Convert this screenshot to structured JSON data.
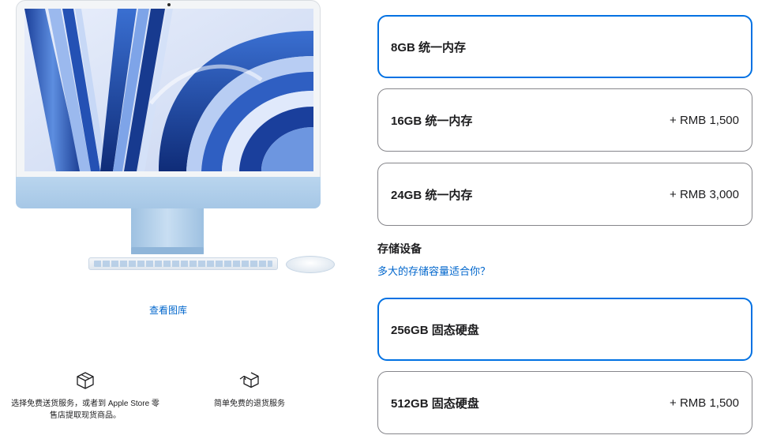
{
  "product": {
    "gallery_link": "查看图库",
    "perks": [
      {
        "icon": "box-icon",
        "line1": "选择免费送货服务，或者到 Apple Store 零",
        "line2": "售店提取现货商品。"
      },
      {
        "icon": "return-box-icon",
        "line1": "简单免费的退货服务"
      }
    ],
    "colors": {
      "accent": "#0071e3",
      "link": "#0066cc",
      "imac_blue": "#a6c7e6"
    }
  },
  "memory": {
    "options": [
      {
        "label": "8GB 统一内存",
        "price": "",
        "selected": true
      },
      {
        "label": "16GB 统一内存",
        "price": "+ RMB 1,500",
        "selected": false
      },
      {
        "label": "24GB 统一内存",
        "price": "+ RMB 3,000",
        "selected": false
      }
    ]
  },
  "storage": {
    "title": "存储设备",
    "help_link": "多大的存储容量适合你？",
    "options": [
      {
        "label": "256GB 固态硬盘",
        "price": "",
        "selected": true
      },
      {
        "label": "512GB 固态硬盘",
        "price": "+ RMB 1,500",
        "selected": false
      }
    ]
  }
}
